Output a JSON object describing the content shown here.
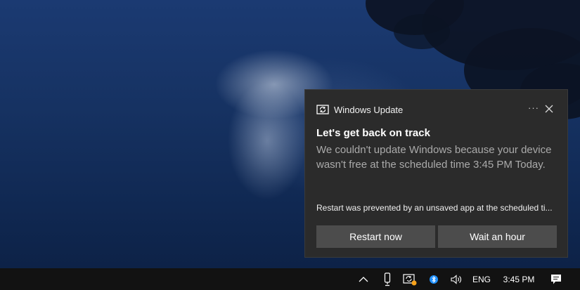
{
  "toast": {
    "app_name": "Windows Update",
    "app_icon": "windows-update-icon",
    "more_glyph": "···",
    "title": "Let's get back on track",
    "body": "We couldn't update Windows because your device wasn't free at the scheduled time 3:45 PM Today.",
    "attribution": "Restart was prevented by an unsaved app at the scheduled ti...",
    "buttons": {
      "restart": "Restart now",
      "wait": "Wait an hour"
    }
  },
  "taskbar": {
    "tray_icons": [
      "chevron-up-icon",
      "phone-icon",
      "windows-update-tray-icon",
      "bluetooth-icon",
      "volume-icon"
    ],
    "language": "ENG",
    "clock": "3:45 PM",
    "action_center_icon": "action-center-icon",
    "colors": {
      "bluetooth": "#1e90ff",
      "update_badge": "#f7a21b"
    }
  }
}
